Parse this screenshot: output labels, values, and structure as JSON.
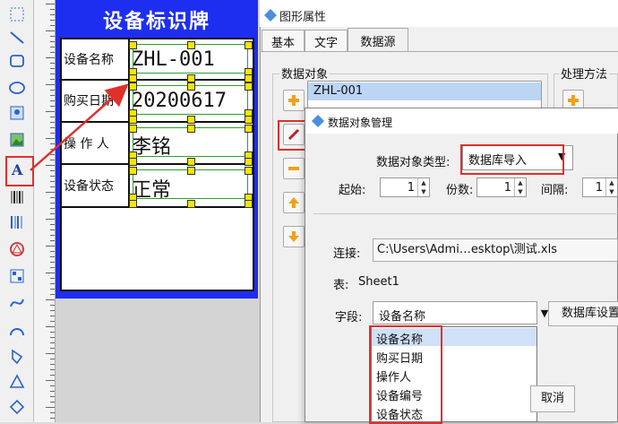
{
  "label": {
    "title": "设备标识牌",
    "rows": [
      {
        "key": "设备名称",
        "value": "ZHL-001"
      },
      {
        "key": "购买日期",
        "value": "20200617"
      },
      {
        "key": "操 作 人",
        "value": "李铭"
      },
      {
        "key": "设备状态",
        "value": "正常"
      }
    ]
  },
  "properties": {
    "title": "图形属性",
    "tabs": [
      "基本",
      "文字",
      "数据源"
    ],
    "active_tab": "数据源",
    "data_objects_label": "数据对象",
    "processing_label": "处理方法",
    "data_objects": [
      "ZHL-001"
    ]
  },
  "manager": {
    "title": "数据对象管理",
    "type_label": "数据对象类型:",
    "type_value": "数据库导入",
    "start_label": "起始:",
    "start_value": "1",
    "copies_label": "份数:",
    "copies_value": "1",
    "interval_label": "间隔:",
    "interval_value": "1",
    "connection_label": "连接:",
    "connection_value": "C:\\Users\\Admi…esktop\\测试.xls",
    "table_label": "表:",
    "table_value": "Sheet1",
    "field_label": "字段:",
    "field_value": "设备名称",
    "db_settings_button": "数据库设置",
    "cancel_button": "取消",
    "field_options": [
      "设备名称",
      "购买日期",
      "操作人",
      "设备编号",
      "设备状态"
    ]
  },
  "colors": {
    "label_blue": "#1e2ef0",
    "highlight_red": "#e0302a",
    "handle_yellow": "#f5e600"
  }
}
